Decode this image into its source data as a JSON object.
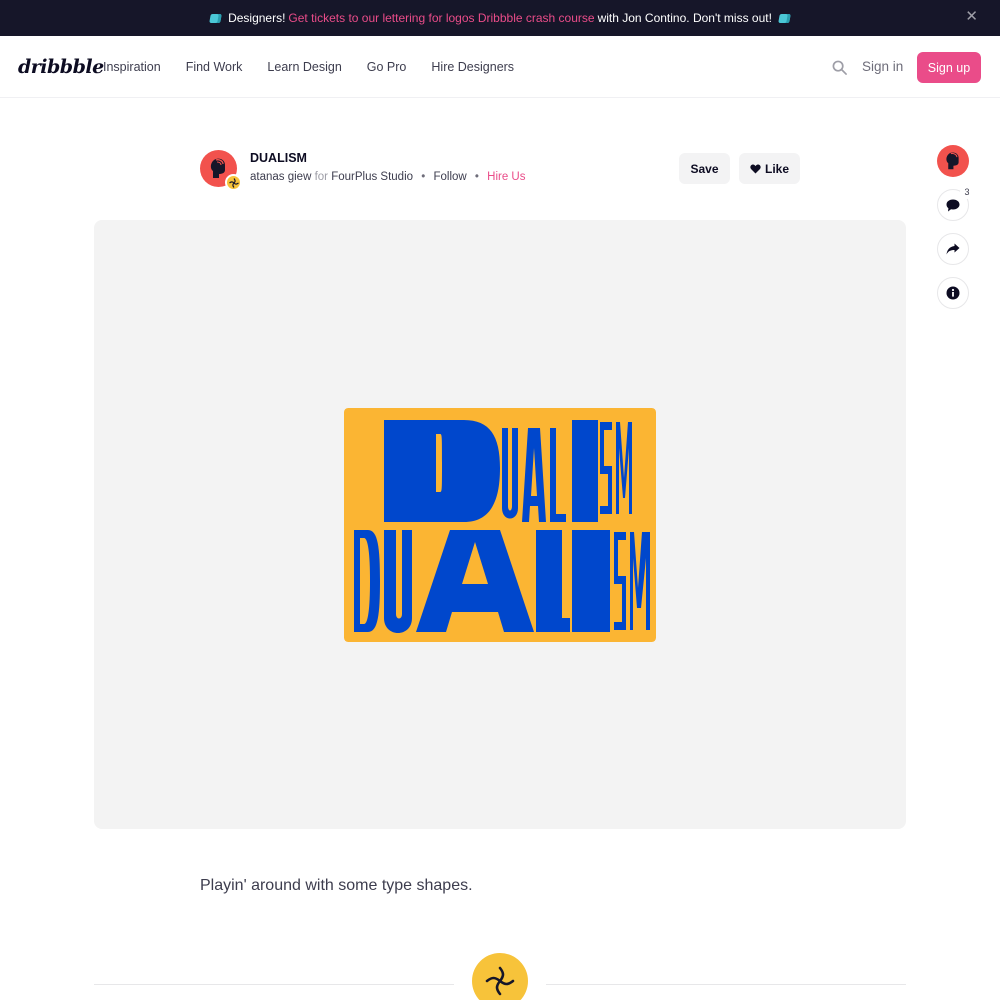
{
  "banner": {
    "prefix": "Designers!",
    "link": "Get tickets to our lettering for logos Dribbble crash course",
    "suffix": "with Jon Contino. Don't miss out!",
    "close": "✕",
    "icon": "ticket-icon",
    "link_color": "#ea4c89"
  },
  "header": {
    "logo": "dribbble",
    "nav": [
      "Inspiration",
      "Find Work",
      "Learn Design",
      "Go Pro",
      "Hire Designers"
    ],
    "search_icon": "search-icon",
    "signin": "Sign in",
    "signup": "Sign up",
    "accent": "#ea4c89"
  },
  "shot": {
    "title": "DUALISM",
    "author": "atanas giew",
    "for_word": "for",
    "team": "FourPlus Studio",
    "follow": "Follow",
    "hire": "Hire Us",
    "separator": "•",
    "save": "Save",
    "like": "Like",
    "description": "Playin' around with some type shapes."
  },
  "sidebar": {
    "comment_count": "3",
    "icons": [
      "avatar",
      "comment-icon",
      "share-icon",
      "info-icon"
    ]
  },
  "artwork": {
    "background": "#fbb533",
    "ink": "#0047cc",
    "row1": [
      "D",
      "U",
      "A",
      "L",
      "I",
      "S",
      "M"
    ],
    "row2": [
      "D",
      "U",
      "A",
      "L",
      "I",
      "S",
      "M"
    ]
  }
}
